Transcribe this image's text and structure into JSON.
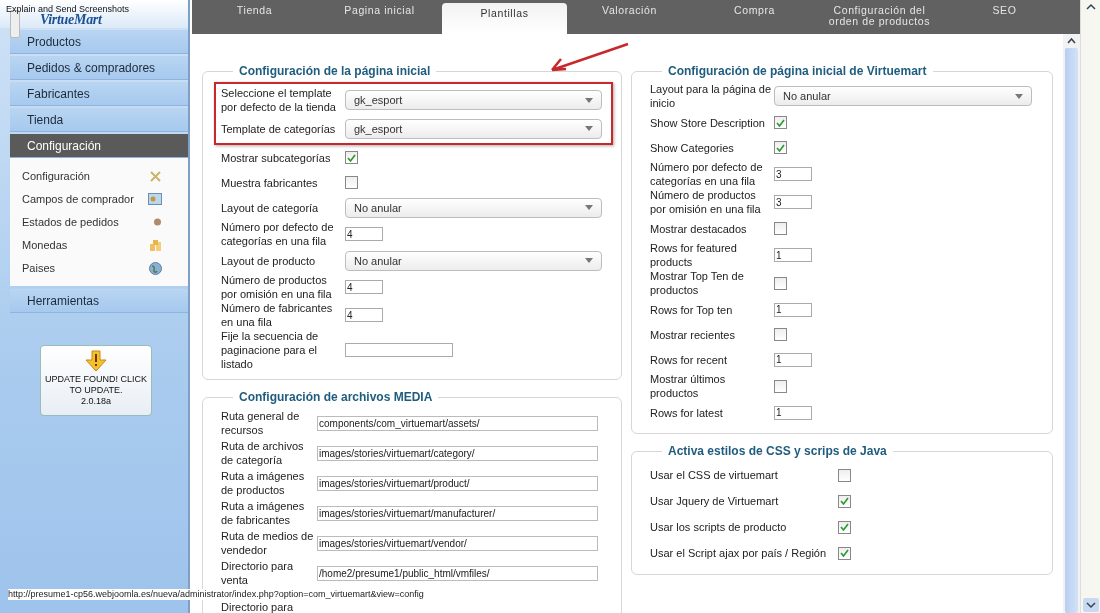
{
  "overlay_caption": "Explain and Send Screenshots",
  "sidebar": {
    "logo": "VirtueMart",
    "menu": [
      {
        "label": "Productos",
        "selected": false
      },
      {
        "label": "Pedidos & compradores",
        "selected": false
      },
      {
        "label": "Fabricantes",
        "selected": false
      },
      {
        "label": "Tienda",
        "selected": false
      },
      {
        "label": "Configuración",
        "selected": true
      }
    ],
    "submenu": [
      {
        "label": "Configuración",
        "kind": "tools"
      },
      {
        "label": "Campos de comprador",
        "kind": "card"
      },
      {
        "label": "Estados de pedidos",
        "kind": "dot"
      },
      {
        "label": "Monedas",
        "kind": "coins"
      },
      {
        "label": "Paises",
        "kind": "globe"
      }
    ],
    "tools": {
      "label": "Herramientas",
      "selected": false
    },
    "update": {
      "message": "UPDATE FOUND! CLICK TO UPDATE.",
      "version": "2.0.18a"
    }
  },
  "tabs": [
    {
      "label": "Tienda",
      "selected": false
    },
    {
      "label": "Pagina inicial",
      "selected": false
    },
    {
      "label": "Plantillas",
      "selected": true
    },
    {
      "label": "Valoración",
      "selected": false
    },
    {
      "label": "Compra",
      "selected": false
    },
    {
      "label": "Configuración del orden de productos",
      "selected": false
    },
    {
      "label": "SEO",
      "selected": false
    }
  ],
  "left_sections": [
    {
      "title": "Configuración de la página inicial",
      "highlighted_rows": [
        {
          "label": "Seleccione el template por defecto de la tienda",
          "kind": "select",
          "value": "gk_esport"
        },
        {
          "label": "Template de categorías",
          "kind": "select",
          "value": "gk_esport"
        }
      ],
      "rows": [
        {
          "label": "Mostrar subcategorías",
          "kind": "checkbox",
          "checked": true
        },
        {
          "label": "Muestra fabricantes",
          "kind": "checkbox",
          "checked": false
        },
        {
          "label": "Layout de categoría",
          "kind": "select",
          "value": "No anular"
        },
        {
          "label": "Número por defecto de categorías en una fila",
          "kind": "number",
          "value": "4"
        },
        {
          "label": "Layout de producto",
          "kind": "select",
          "value": "No anular"
        },
        {
          "label": "Número de productos por omisión en una fila",
          "kind": "number",
          "value": "4"
        },
        {
          "label": "Número de fabricantes en una fila",
          "kind": "number",
          "value": "4"
        },
        {
          "label": "Fije la secuencia de paginacione para el listado",
          "kind": "wide",
          "value": ""
        }
      ]
    },
    {
      "title": "Configuración de archivos MEDIA",
      "rows": [
        {
          "label": "Ruta general de recursos",
          "kind": "path",
          "value": "components/com_virtuemart/assets/"
        },
        {
          "label": "Ruta de archivos de categoría",
          "kind": "path",
          "value": "images/stories/virtuemart/category/"
        },
        {
          "label": "Ruta a imágenes de productos",
          "kind": "path",
          "value": "images/stories/virtuemart/product/"
        },
        {
          "label": "Ruta a imágenes de fabricantes",
          "kind": "path",
          "value": "images/stories/virtuemart/manufacturer/"
        },
        {
          "label": "Ruta de medios de vendedor",
          "kind": "path",
          "value": "images/stories/virtuemart/vendor/"
        },
        {
          "label": "Directorio para venta",
          "kind": "path",
          "value": "/home2/presume1/public_html/vmfiles/"
        },
        {
          "label": "Directorio para",
          "kind": "label"
        }
      ]
    }
  ],
  "right_sections": [
    {
      "title": "Configuración de página inicial de Virtuemart",
      "rows": [
        {
          "label": "Layout para la página de inicio",
          "kind": "select",
          "value": "No anular"
        },
        {
          "label": "Show Store Description",
          "kind": "checkbox",
          "checked": true
        },
        {
          "label": "Show Categories",
          "kind": "checkbox",
          "checked": true
        },
        {
          "label": "Número por defecto de categorías en una fila",
          "kind": "number",
          "value": "3"
        },
        {
          "label": "Número de productos por omisión en una fila",
          "kind": "number",
          "value": "3"
        },
        {
          "label": "Mostrar destacados",
          "kind": "checkbox",
          "checked": false
        },
        {
          "label": "Rows for featured products",
          "kind": "number",
          "value": "1"
        },
        {
          "label": "Mostrar Top Ten de productos",
          "kind": "checkbox",
          "checked": false
        },
        {
          "label": "Rows for Top ten",
          "kind": "number",
          "value": "1"
        },
        {
          "label": "Mostrar recientes",
          "kind": "checkbox",
          "checked": false
        },
        {
          "label": "Rows for recent",
          "kind": "number",
          "value": "1"
        },
        {
          "label": "Mostrar últimos productos",
          "kind": "checkbox",
          "checked": false
        },
        {
          "label": "Rows for latest",
          "kind": "number",
          "value": "1"
        }
      ]
    },
    {
      "title": "Activa estilos de CSS y scrips de Java",
      "rows": [
        {
          "label": "Usar el CSS de virtuemart",
          "kind": "checkbox",
          "checked": false
        },
        {
          "label": "Usar Jquery de Virtuemart",
          "kind": "checkbox",
          "checked": true
        },
        {
          "label": "Usar los scripts de producto",
          "kind": "checkbox",
          "checked": true
        },
        {
          "label": "Usar el Script ajax por país / Región",
          "kind": "checkbox",
          "checked": true
        }
      ]
    }
  ],
  "status_url": "http://presume1-cp56.webjoomla.es/nueva/administrator/index.php?option=com_virtuemart&view=config"
}
